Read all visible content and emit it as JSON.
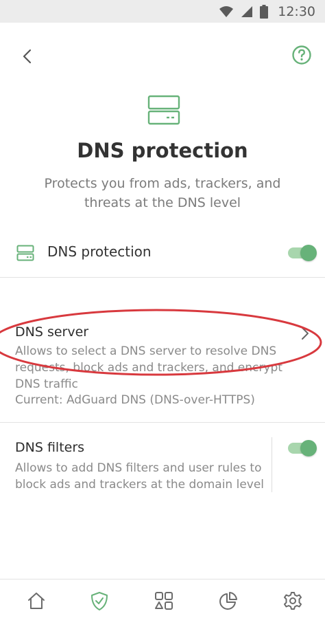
{
  "status_bar": {
    "time": "12:30",
    "icons": [
      "wifi-icon",
      "signal-icon",
      "battery-icon"
    ]
  },
  "header": {
    "back_icon": "chevron-left-icon",
    "help_icon": "help-circle-icon",
    "title": "DNS protection",
    "subtitle": "Protects you from ads, trackers, and threats at the DNS level"
  },
  "main_toggle": {
    "label": "DNS protection",
    "enabled": true
  },
  "dns_server": {
    "title": "DNS server",
    "desc_line1": "Allows to select a DNS server to resolve DNS",
    "desc_line2": "requests, block ads and trackers, and encrypt",
    "desc_line3": "DNS traffic",
    "current": "Current: AdGuard DNS (DNS-over-HTTPS)"
  },
  "dns_filters": {
    "title": "DNS filters",
    "desc_line1": "Allows to add DNS filters and user rules to",
    "desc_line2": "block ads and trackers at the domain level",
    "enabled": true
  },
  "bottom_nav": {
    "items": [
      "home-icon",
      "shield-check-icon",
      "apps-icon",
      "stats-pie-icon",
      "settings-gear-icon"
    ],
    "active_index": 1
  },
  "colors": {
    "accent": "#67b279",
    "accent_light": "#a8d6ad",
    "highlight": "#d8393e"
  }
}
